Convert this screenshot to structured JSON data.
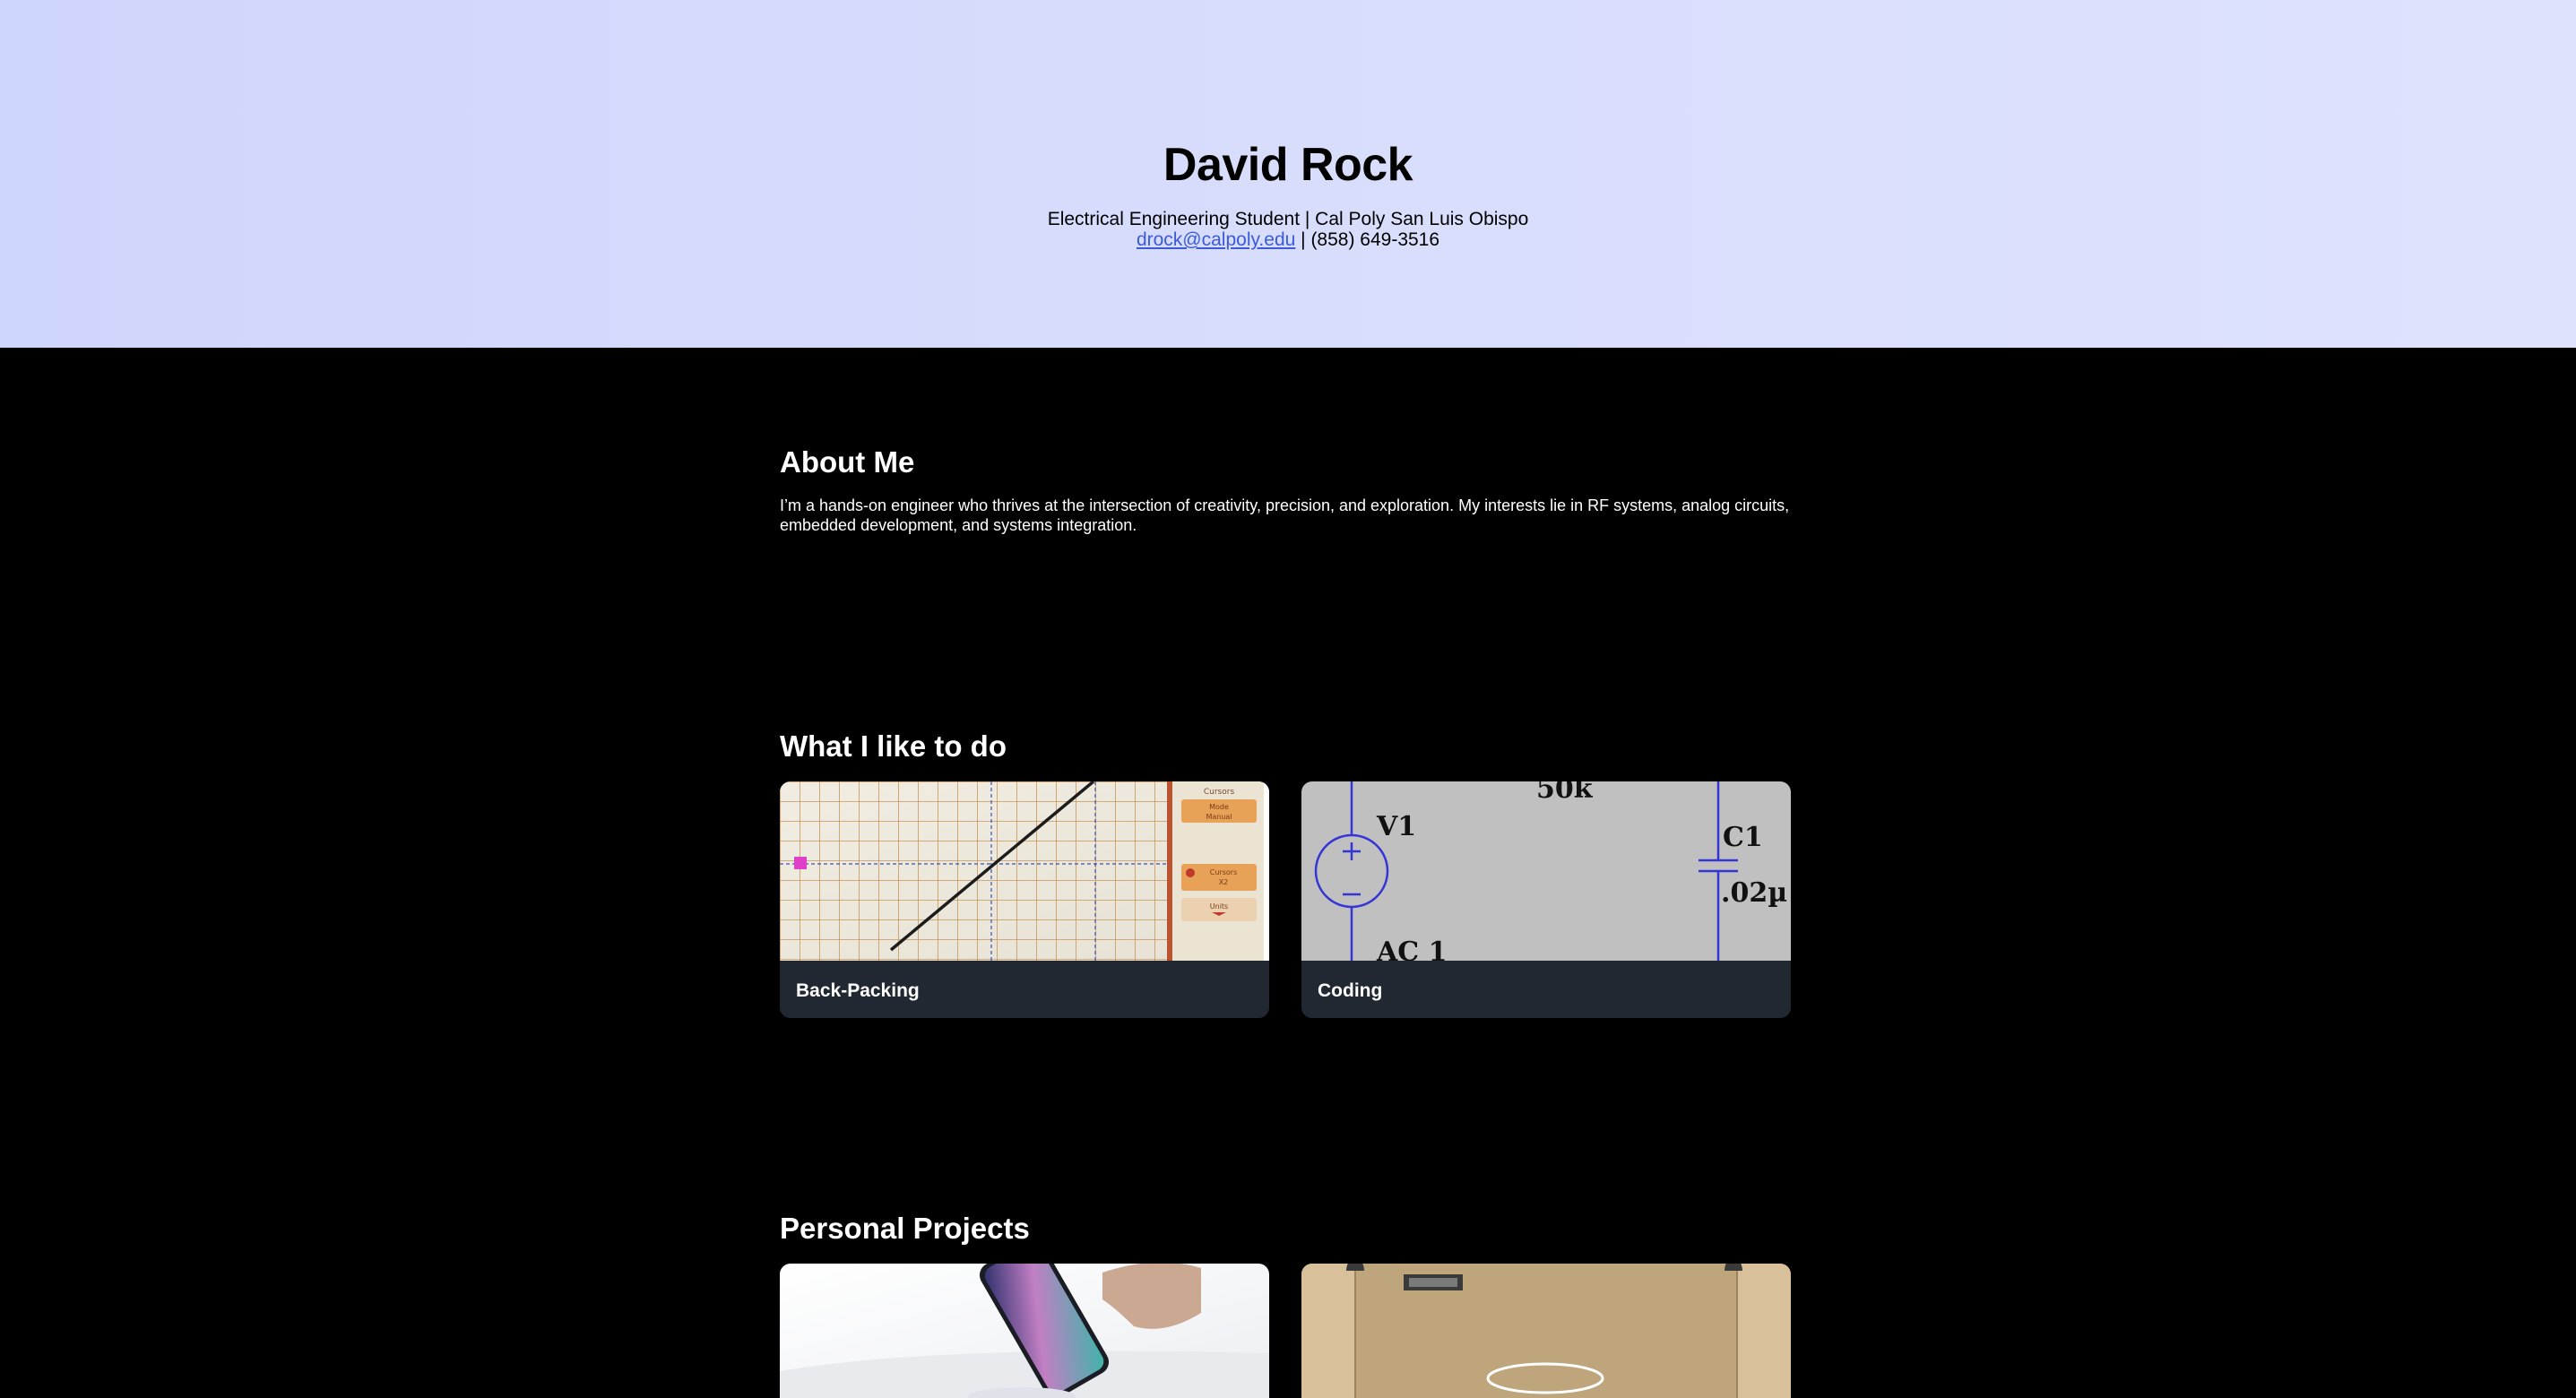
{
  "header": {
    "name": "David Rock",
    "subtitle": "Electrical Engineering Student | Cal Poly San Luis Obispo",
    "email": "drock@calpoly.edu",
    "separator": " | ",
    "phone": "(858) 649-3516"
  },
  "about": {
    "title": "About Me",
    "text": "I’m a hands-on engineer who thrives at the intersection of creativity, precision, and exploration. My interests lie in RF systems, analog circuits, embedded development, and systems integration."
  },
  "hobbies": {
    "title": "What I like to do",
    "cards": [
      {
        "label": "Back-Packing",
        "image_icon": "oscilloscope-photo"
      },
      {
        "label": "Coding",
        "image_icon": "circuit-schematic"
      }
    ],
    "schematic": {
      "resistor": "50k",
      "source": "V1",
      "source_value": "AC 1",
      "capacitor": "C1",
      "capacitor_value": ".02µ"
    },
    "scope_panel": {
      "title": "Cursors",
      "mode": "Mode",
      "manual": "Manual",
      "cursors": "Cursors",
      "cursor_value": "X2",
      "units": "Units"
    }
  },
  "projects": {
    "title": "Personal Projects",
    "cards": [
      {
        "image_icon": "phone-charging-photo"
      },
      {
        "image_icon": "cardboard-box-photo"
      }
    ]
  },
  "colors": {
    "header_bg": "#d8ddfc",
    "page_bg": "#000000",
    "card_caption_bg": "#222832",
    "link": "#3b5bdb"
  }
}
